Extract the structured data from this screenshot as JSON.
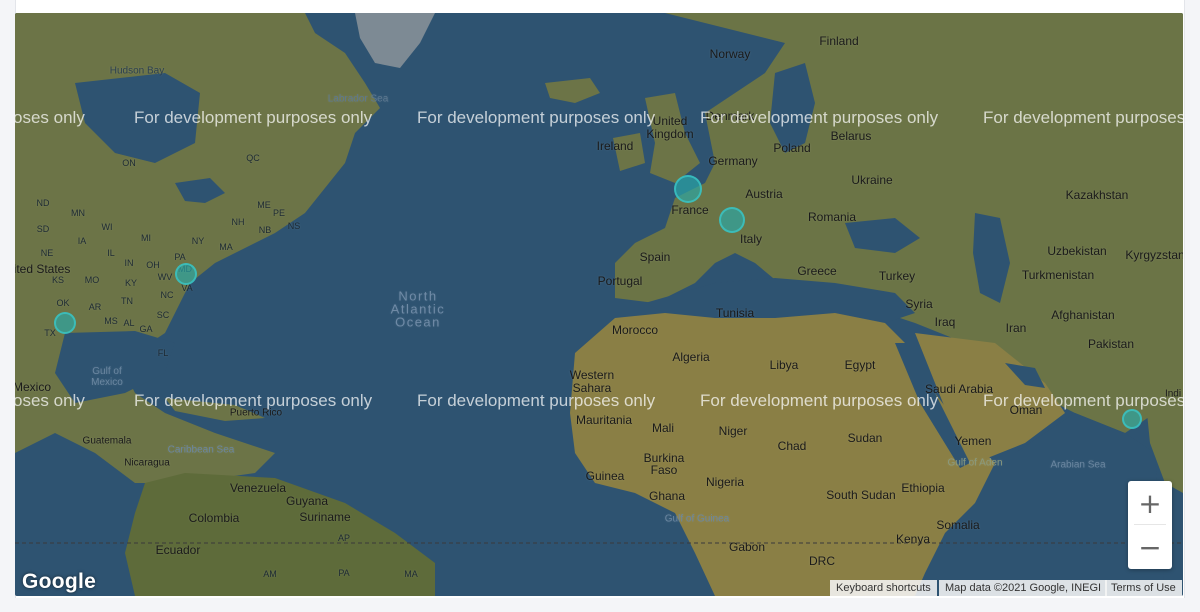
{
  "map": {
    "zoom_in_label": "+",
    "zoom_out_label": "−",
    "logo": "Google",
    "attribution": {
      "shortcuts": "Keyboard shortcuts",
      "data": "Map data ©2021 Google, INEGI",
      "terms": "Terms of Use"
    },
    "watermark_text": "For development purposes only",
    "watermark_partial": "oses only",
    "water_color": "#2e5371",
    "land_color": "#6f7749",
    "marker_color": "#2aaaaa",
    "labels": {
      "hudson_bay": "Hudson Bay",
      "labrador_sea": "Labrador Sea",
      "north_atlantic": "North\nAtlantic\nOcean",
      "gulf_mexico": "Gulf of\nMexico",
      "caribbean": "Caribbean Sea",
      "gulf_guinea": "Gulf of Guinea",
      "gulf_aden": "Gulf of Aden",
      "arabian_sea": "Arabian Sea",
      "finland": "Finland",
      "norway": "Norway",
      "denmark": "Denmark",
      "united_kingdom": "United\nKingdom",
      "ireland": "Ireland",
      "belarus": "Belarus",
      "poland": "Poland",
      "germany": "Germany",
      "ukraine": "Ukraine",
      "kazakhstan": "Kazakhstan",
      "france": "France",
      "austria": "Austria",
      "romania": "Romania",
      "italy": "Italy",
      "spain": "Spain",
      "portugal": "Portugal",
      "uzbekistan": "Uzbekistan",
      "kyrgyzstan": "Kyrgyzstan",
      "turkmenistan": "Turkmenistan",
      "greece": "Greece",
      "turkey": "Turkey",
      "syria": "Syria",
      "iraq": "Iraq",
      "iran": "Iran",
      "afghanistan": "Afghanistan",
      "pakistan": "Pakistan",
      "tunisia": "Tunisia",
      "morocco": "Morocco",
      "algeria": "Algeria",
      "libya": "Libya",
      "egypt": "Egypt",
      "western_sahara": "Western\nSahara",
      "saudi_arabia": "Saudi Arabia",
      "oman": "Oman",
      "mauritania": "Mauritania",
      "mali": "Mali",
      "niger": "Niger",
      "chad": "Chad",
      "sudan": "Sudan",
      "yemen": "Yemen",
      "burkina_faso": "Burkina\nFaso",
      "guinea": "Guinea",
      "ghana": "Ghana",
      "nigeria": "Nigeria",
      "ethiopia": "Ethiopia",
      "south_sudan": "South Sudan",
      "somalia": "Somalia",
      "gabon": "Gabon",
      "kenya": "Kenya",
      "drc": "DRC",
      "india": "Indi",
      "united_states": "ited States",
      "mexico": "Mexico",
      "guatemala": "Guatemala",
      "nicaragua": "Nicaragua",
      "puerto_rico": "Puerto Rico",
      "venezuela": "Venezuela",
      "guyana": "Guyana",
      "suriname": "Suriname",
      "colombia": "Colombia",
      "ecuador": "Ecuador",
      "on": "ON",
      "qc": "QC",
      "nd": "ND",
      "sd": "SD",
      "ne": "NE",
      "ia": "IA",
      "il": "IL",
      "mo": "MO",
      "ks": "KS",
      "ok": "OK",
      "tx": "TX",
      "ar": "AR",
      "ms": "MS",
      "al": "AL",
      "ga": "GA",
      "sc": "SC",
      "nc": "NC",
      "tn": "TN",
      "ky": "KY",
      "wv": "WV",
      "va": "VA",
      "md": "MD",
      "pa": "PA",
      "ny": "NY",
      "ma": "MA",
      "nh": "NH",
      "me": "ME",
      "nb": "NB",
      "pe": "PE",
      "ns": "NS",
      "oh": "OH",
      "in": "IN",
      "mi": "MI",
      "wi": "WI",
      "mn": "MN",
      "fl": "FL",
      "am": "AM",
      "pa_br": "PA",
      "ap": "AP",
      "ma_br": "MA"
    }
  }
}
